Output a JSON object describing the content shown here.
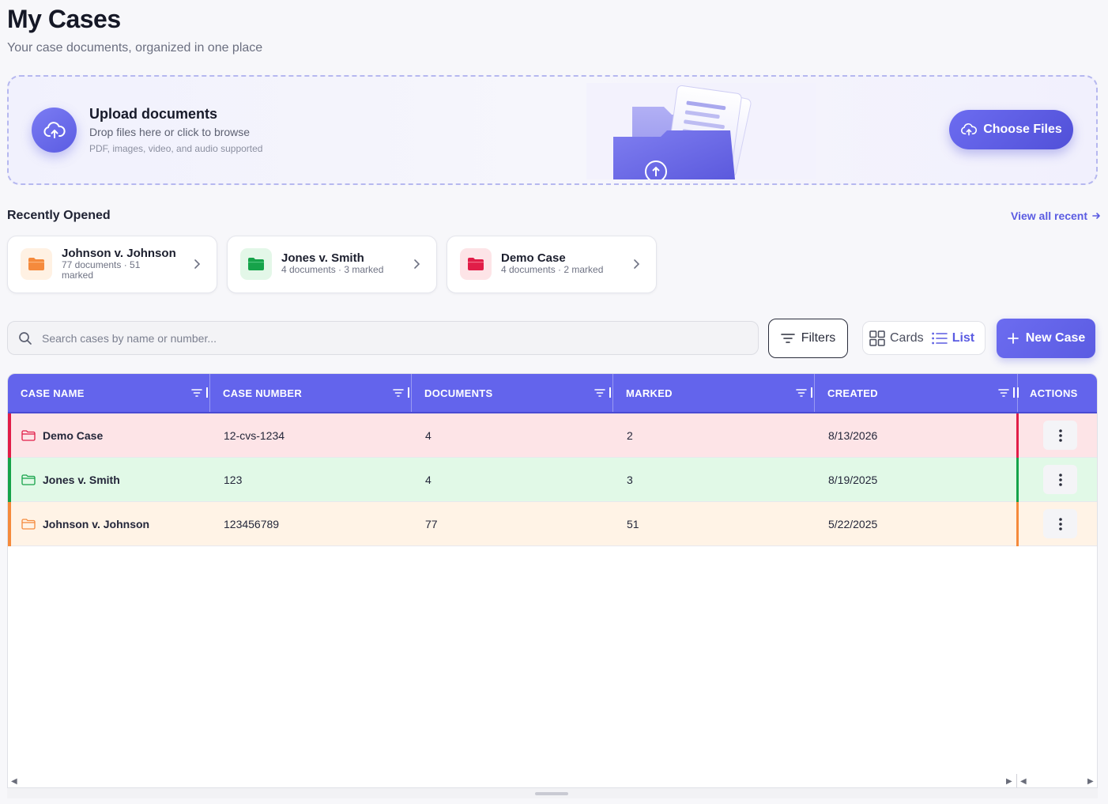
{
  "header": {
    "title": "My Cases",
    "subtitle": "Your case documents, organized in one place"
  },
  "upload": {
    "title": "Upload documents",
    "subtitle": "Drop files here or click to browse",
    "note": "PDF, images, video, and audio supported",
    "button_label": "Choose Files"
  },
  "recent": {
    "title": "Recently Opened",
    "view_all_label": "View all recent",
    "items": [
      {
        "name": "Johnson v. Johnson",
        "meta": "77 documents · 51 marked",
        "color": "#f58a3c",
        "bg": "#fff1e3"
      },
      {
        "name": "Jones v. Smith",
        "meta": "4 documents · 3 marked",
        "color": "#16a34a",
        "bg": "#e3f7e8"
      },
      {
        "name": "Demo Case",
        "meta": "4 documents · 2 marked",
        "color": "#e11d48",
        "bg": "#fde4e7"
      }
    ]
  },
  "toolbar": {
    "search_placeholder": "Search cases by name or number...",
    "filters_label": "Filters",
    "view_cards_label": "Cards",
    "view_list_label": "List",
    "active_view": "List",
    "new_case_label": "New Case"
  },
  "table": {
    "columns": [
      "CASE NAME",
      "CASE NUMBER",
      "DOCUMENTS",
      "MARKED",
      "CREATED",
      "ACTIONS"
    ],
    "rows": [
      {
        "name": "Demo Case",
        "number": "12-cvs-1234",
        "documents": "4",
        "marked": "2",
        "created": "8/13/2026",
        "color": "#e11d48",
        "bg": "#fde4e7"
      },
      {
        "name": "Jones v. Smith",
        "number": "123",
        "documents": "4",
        "marked": "3",
        "created": "8/19/2025",
        "color": "#16a34a",
        "bg": "#e1f9e7"
      },
      {
        "name": "Johnson v. Johnson",
        "number": "123456789",
        "documents": "77",
        "marked": "51",
        "created": "5/22/2025",
        "color": "#f58a3c",
        "bg": "#fff3e6"
      }
    ]
  },
  "colors": {
    "accent": "#5b5ce2",
    "header_bg": "#6364ec"
  }
}
